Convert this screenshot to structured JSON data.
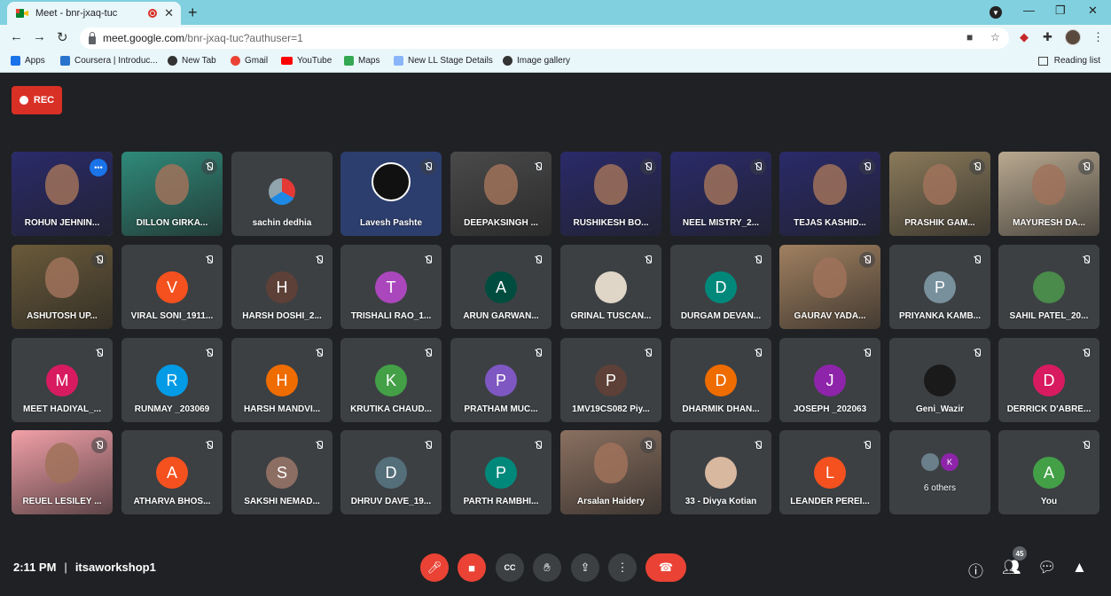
{
  "browser": {
    "tab_title": "Meet - bnr-jxaq-tuc",
    "new_tab_icon": "+",
    "close_icon": "✕",
    "window_minimize": "—",
    "window_maximize": "❐",
    "window_close": "✕",
    "url_host": "meet.google.com",
    "url_path": "/bnr-jxaq-tuc?authuser=1"
  },
  "bookmarks": {
    "items": [
      {
        "label": "Apps",
        "icon": "apps-grid-icon",
        "color": "#1a73e8"
      },
      {
        "label": "Coursera | Introduc...",
        "icon": "coursera-icon",
        "color": "#2a73cc"
      },
      {
        "label": "New Tab",
        "icon": "globe-icon",
        "color": "#333333"
      },
      {
        "label": "Gmail",
        "icon": "google-icon",
        "color": "#ea4335"
      },
      {
        "label": "YouTube",
        "icon": "youtube-icon",
        "color": "#ff0000"
      },
      {
        "label": "Maps",
        "icon": "maps-icon",
        "color": "#34a853"
      },
      {
        "label": "New LL Stage Details",
        "icon": "page-icon",
        "color": "#8ab4f8"
      },
      {
        "label": "Image gallery",
        "icon": "globe-icon",
        "color": "#333333"
      }
    ],
    "reading_list": "Reading list"
  },
  "meet": {
    "rec_label": "REC",
    "time": "2:11 PM",
    "separator": "|",
    "meeting_name": "itsaworkshop1",
    "people_count": "45",
    "participants": [
      {
        "name": "ROHUN JEHNIN...",
        "type": "video",
        "bg": "#2a2a6a",
        "active": true
      },
      {
        "name": "DILLON GIRKA...",
        "type": "video",
        "bg": "#2f8a7a",
        "muted": true
      },
      {
        "name": "sachin dedhia",
        "type": "logo",
        "bg": "#3c4043"
      },
      {
        "name": "Lavesh Pashte",
        "type": "logo-obs",
        "bg": "#2c3e6e",
        "muted": true
      },
      {
        "name": "DEEPAKSINGH ...",
        "type": "video",
        "bg": "#4a4a4a",
        "muted": true
      },
      {
        "name": "RUSHIKESH BO...",
        "type": "video",
        "bg": "#2a2a6a",
        "muted": true
      },
      {
        "name": "NEEL MISTRY_2...",
        "type": "video",
        "bg": "#2a2a6a",
        "muted": true
      },
      {
        "name": "TEJAS KASHID...",
        "type": "video",
        "bg": "#2a2a6a",
        "muted": true
      },
      {
        "name": "PRASHIK GAM...",
        "type": "video",
        "bg": "#8a7a5a",
        "muted": true
      },
      {
        "name": "MAYURESH DA...",
        "type": "video",
        "bg": "#b9a990",
        "muted": true
      },
      {
        "name": "ASHUTOSH UP...",
        "type": "video",
        "bg": "#6a5a3a",
        "muted": true
      },
      {
        "name": "VIRAL SONI_1911...",
        "type": "avatar",
        "initial": "V",
        "color": "#f4511e",
        "muted": true
      },
      {
        "name": "HARSH DOSHI_2...",
        "type": "avatar",
        "initial": "H",
        "color": "#5d4037",
        "muted": true
      },
      {
        "name": "TRISHALI RAO_1...",
        "type": "avatar",
        "initial": "T",
        "color": "#ab47bc",
        "muted": true
      },
      {
        "name": "ARUN GARWAN...",
        "type": "avatar",
        "initial": "A",
        "color": "#004d40",
        "muted": true
      },
      {
        "name": "GRINAL TUSCAN...",
        "type": "photo",
        "color": "#e0d6c8",
        "muted": true
      },
      {
        "name": "DURGAM DEVAN...",
        "type": "avatar",
        "initial": "D",
        "color": "#00897b",
        "muted": true
      },
      {
        "name": "GAURAV YADA...",
        "type": "video",
        "bg": "#a08060",
        "muted": true
      },
      {
        "name": "PRIYANKA KAMB...",
        "type": "avatar",
        "initial": "P",
        "color": "#78909c",
        "muted": true
      },
      {
        "name": "SAHIL PATEL_20...",
        "type": "photo",
        "color": "#4a8a4a",
        "muted": true
      },
      {
        "name": "MEET HADIYAL_...",
        "type": "avatar",
        "initial": "M",
        "color": "#d81b60",
        "muted": true
      },
      {
        "name": "RUNMAY _203069",
        "type": "avatar",
        "initial": "R",
        "color": "#039be5",
        "muted": true
      },
      {
        "name": "HARSH MANDVI...",
        "type": "avatar",
        "initial": "H",
        "color": "#ef6c00",
        "muted": true
      },
      {
        "name": "KRUTIKA CHAUD...",
        "type": "avatar",
        "initial": "K",
        "color": "#43a047",
        "muted": true
      },
      {
        "name": "PRATHAM MUC...",
        "type": "avatar",
        "initial": "P",
        "color": "#7e57c2",
        "muted": true
      },
      {
        "name": "1MV19CS082 Piy...",
        "type": "avatar",
        "initial": "P",
        "color": "#5d4037",
        "muted": true
      },
      {
        "name": "DHARMIK DHAN...",
        "type": "avatar",
        "initial": "D",
        "color": "#ef6c00",
        "muted": true
      },
      {
        "name": "JOSEPH _202063",
        "type": "avatar",
        "initial": "J",
        "color": "#8e24aa",
        "muted": true
      },
      {
        "name": "Geni_Wazir",
        "type": "photo",
        "color": "#1a1a1a",
        "muted": true
      },
      {
        "name": "DERRICK D'ABRE...",
        "type": "avatar",
        "initial": "D",
        "color": "#d81b60",
        "muted": true
      },
      {
        "name": "REUEL LESILEY ...",
        "type": "video",
        "bg": "#f2a0a8",
        "muted": true
      },
      {
        "name": "ATHARVA BHOS...",
        "type": "avatar",
        "initial": "A",
        "color": "#f4511e",
        "muted": true
      },
      {
        "name": "SAKSHI NEMAD...",
        "type": "avatar",
        "initial": "S",
        "color": "#8d6e63",
        "muted": true
      },
      {
        "name": "DHRUV DAVE_19...",
        "type": "avatar",
        "initial": "D",
        "color": "#546e7a",
        "muted": true
      },
      {
        "name": "PARTH RAMBHI...",
        "type": "avatar",
        "initial": "P",
        "color": "#00897b",
        "muted": true
      },
      {
        "name": "Arsalan Haidery",
        "type": "video",
        "bg": "#8a7060",
        "muted": true
      },
      {
        "name": "33 - Divya Kotian",
        "type": "photo",
        "color": "#d9b8a0",
        "muted": true
      },
      {
        "name": "LEANDER PEREI...",
        "type": "avatar",
        "initial": "L",
        "color": "#f4511e",
        "muted": true
      },
      {
        "name": "6 others",
        "type": "others",
        "initial": "K"
      },
      {
        "name": "You",
        "type": "avatar",
        "initial": "A",
        "color": "#43a047",
        "muted": true
      }
    ]
  }
}
